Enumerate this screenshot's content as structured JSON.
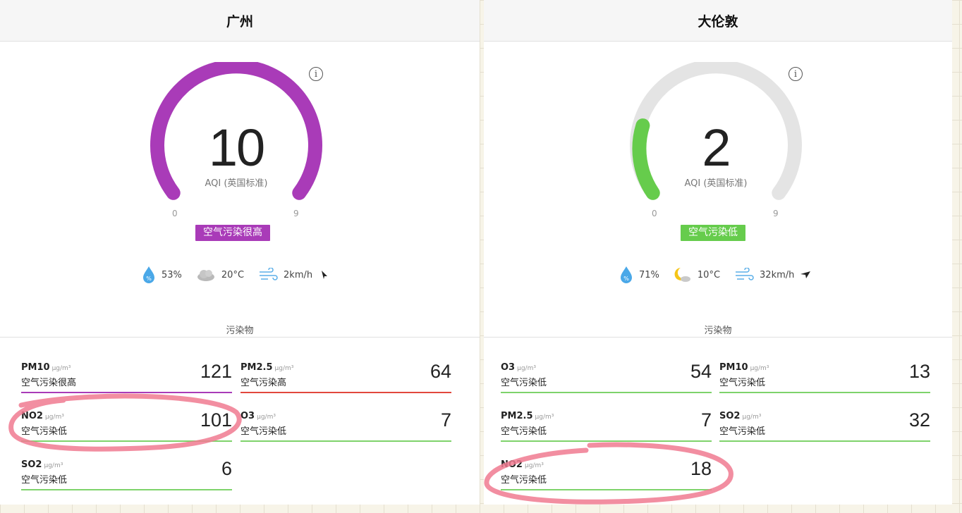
{
  "cities": [
    {
      "name": "广州",
      "aqi": "10",
      "aqi_label": "AQI (英国标准)",
      "scale_min": "0",
      "scale_max": "9",
      "level": "空气污染很高",
      "level_color": "#a93bb8",
      "weather": {
        "humidity": "53%",
        "temp": "20°C",
        "wind": "2km/h",
        "condition_icon": "cloudy-icon"
      },
      "pollutants_title": "污染物",
      "pollutants": [
        {
          "name": "PM10",
          "unit": "μg/m³",
          "level": "空气污染很高",
          "value": "121",
          "color": "#a93bb8"
        },
        {
          "name": "PM2.5",
          "unit": "μg/m³",
          "level": "空气污染高",
          "value": "64",
          "color": "#e2473d"
        },
        {
          "name": "NO2",
          "unit": "μg/m³",
          "level": "空气污染低",
          "value": "101",
          "color": "#7ed36b"
        },
        {
          "name": "O3",
          "unit": "μg/m³",
          "level": "空气污染低",
          "value": "7",
          "color": "#7ed36b"
        },
        {
          "name": "SO2",
          "unit": "μg/m³",
          "level": "空气污染低",
          "value": "6",
          "color": "#7ed36b"
        }
      ]
    },
    {
      "name": "大伦敦",
      "aqi": "2",
      "aqi_label": "AQI (英国标准)",
      "scale_min": "0",
      "scale_max": "9",
      "level": "空气污染低",
      "level_color": "#66cc4c",
      "weather": {
        "humidity": "71%",
        "temp": "10°C",
        "wind": "32km/h",
        "condition_icon": "moon-cloud-icon"
      },
      "pollutants_title": "污染物",
      "pollutants": [
        {
          "name": "O3",
          "unit": "μg/m³",
          "level": "空气污染低",
          "value": "54",
          "color": "#7ed36b"
        },
        {
          "name": "PM10",
          "unit": "μg/m³",
          "level": "空气污染低",
          "value": "13",
          "color": "#7ed36b"
        },
        {
          "name": "PM2.5",
          "unit": "μg/m³",
          "level": "空气污染低",
          "value": "7",
          "color": "#7ed36b"
        },
        {
          "name": "SO2",
          "unit": "μg/m³",
          "level": "空气污染低",
          "value": "32",
          "color": "#7ed36b"
        },
        {
          "name": "NO2",
          "unit": "μg/m³",
          "level": "空气污染低",
          "value": "18",
          "color": "#7ed36b"
        }
      ]
    }
  ],
  "annotation_color": "#f07a90"
}
